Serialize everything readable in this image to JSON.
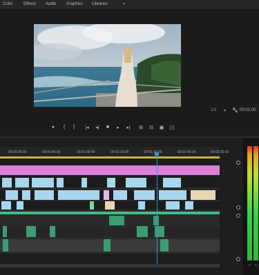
{
  "menu": {
    "items": [
      "Color",
      "Effects",
      "Audio",
      "Graphics",
      "Libraries"
    ],
    "overflow": "»"
  },
  "program_monitor": {
    "fit": "1/2",
    "fit_dropdown": "▾",
    "timecode": "00:02:00:"
  },
  "transport": {
    "buttons": [
      "●",
      "{",
      "}",
      "|◂",
      "◂|",
      "■",
      "▸",
      "▸|",
      "⊞",
      "⊟",
      "▣",
      "◳"
    ]
  },
  "timeline": {
    "ruler_ticks": [
      "00:00:30:00",
      "00:00:45:00",
      "00:01:00:00",
      "00:01:15:00",
      "00:01:30:00",
      "00:01:45:00",
      "00:02:00:00"
    ],
    "accent_colors": {
      "title_track": "#d97fd8",
      "video_clip": "#a7d6ef",
      "audio_clip": "#3e9c72",
      "playhead": "#3b8fd6",
      "work_area": "#c8b642"
    }
  },
  "meters": {
    "label_left": "S",
    "label_right": "S"
  }
}
